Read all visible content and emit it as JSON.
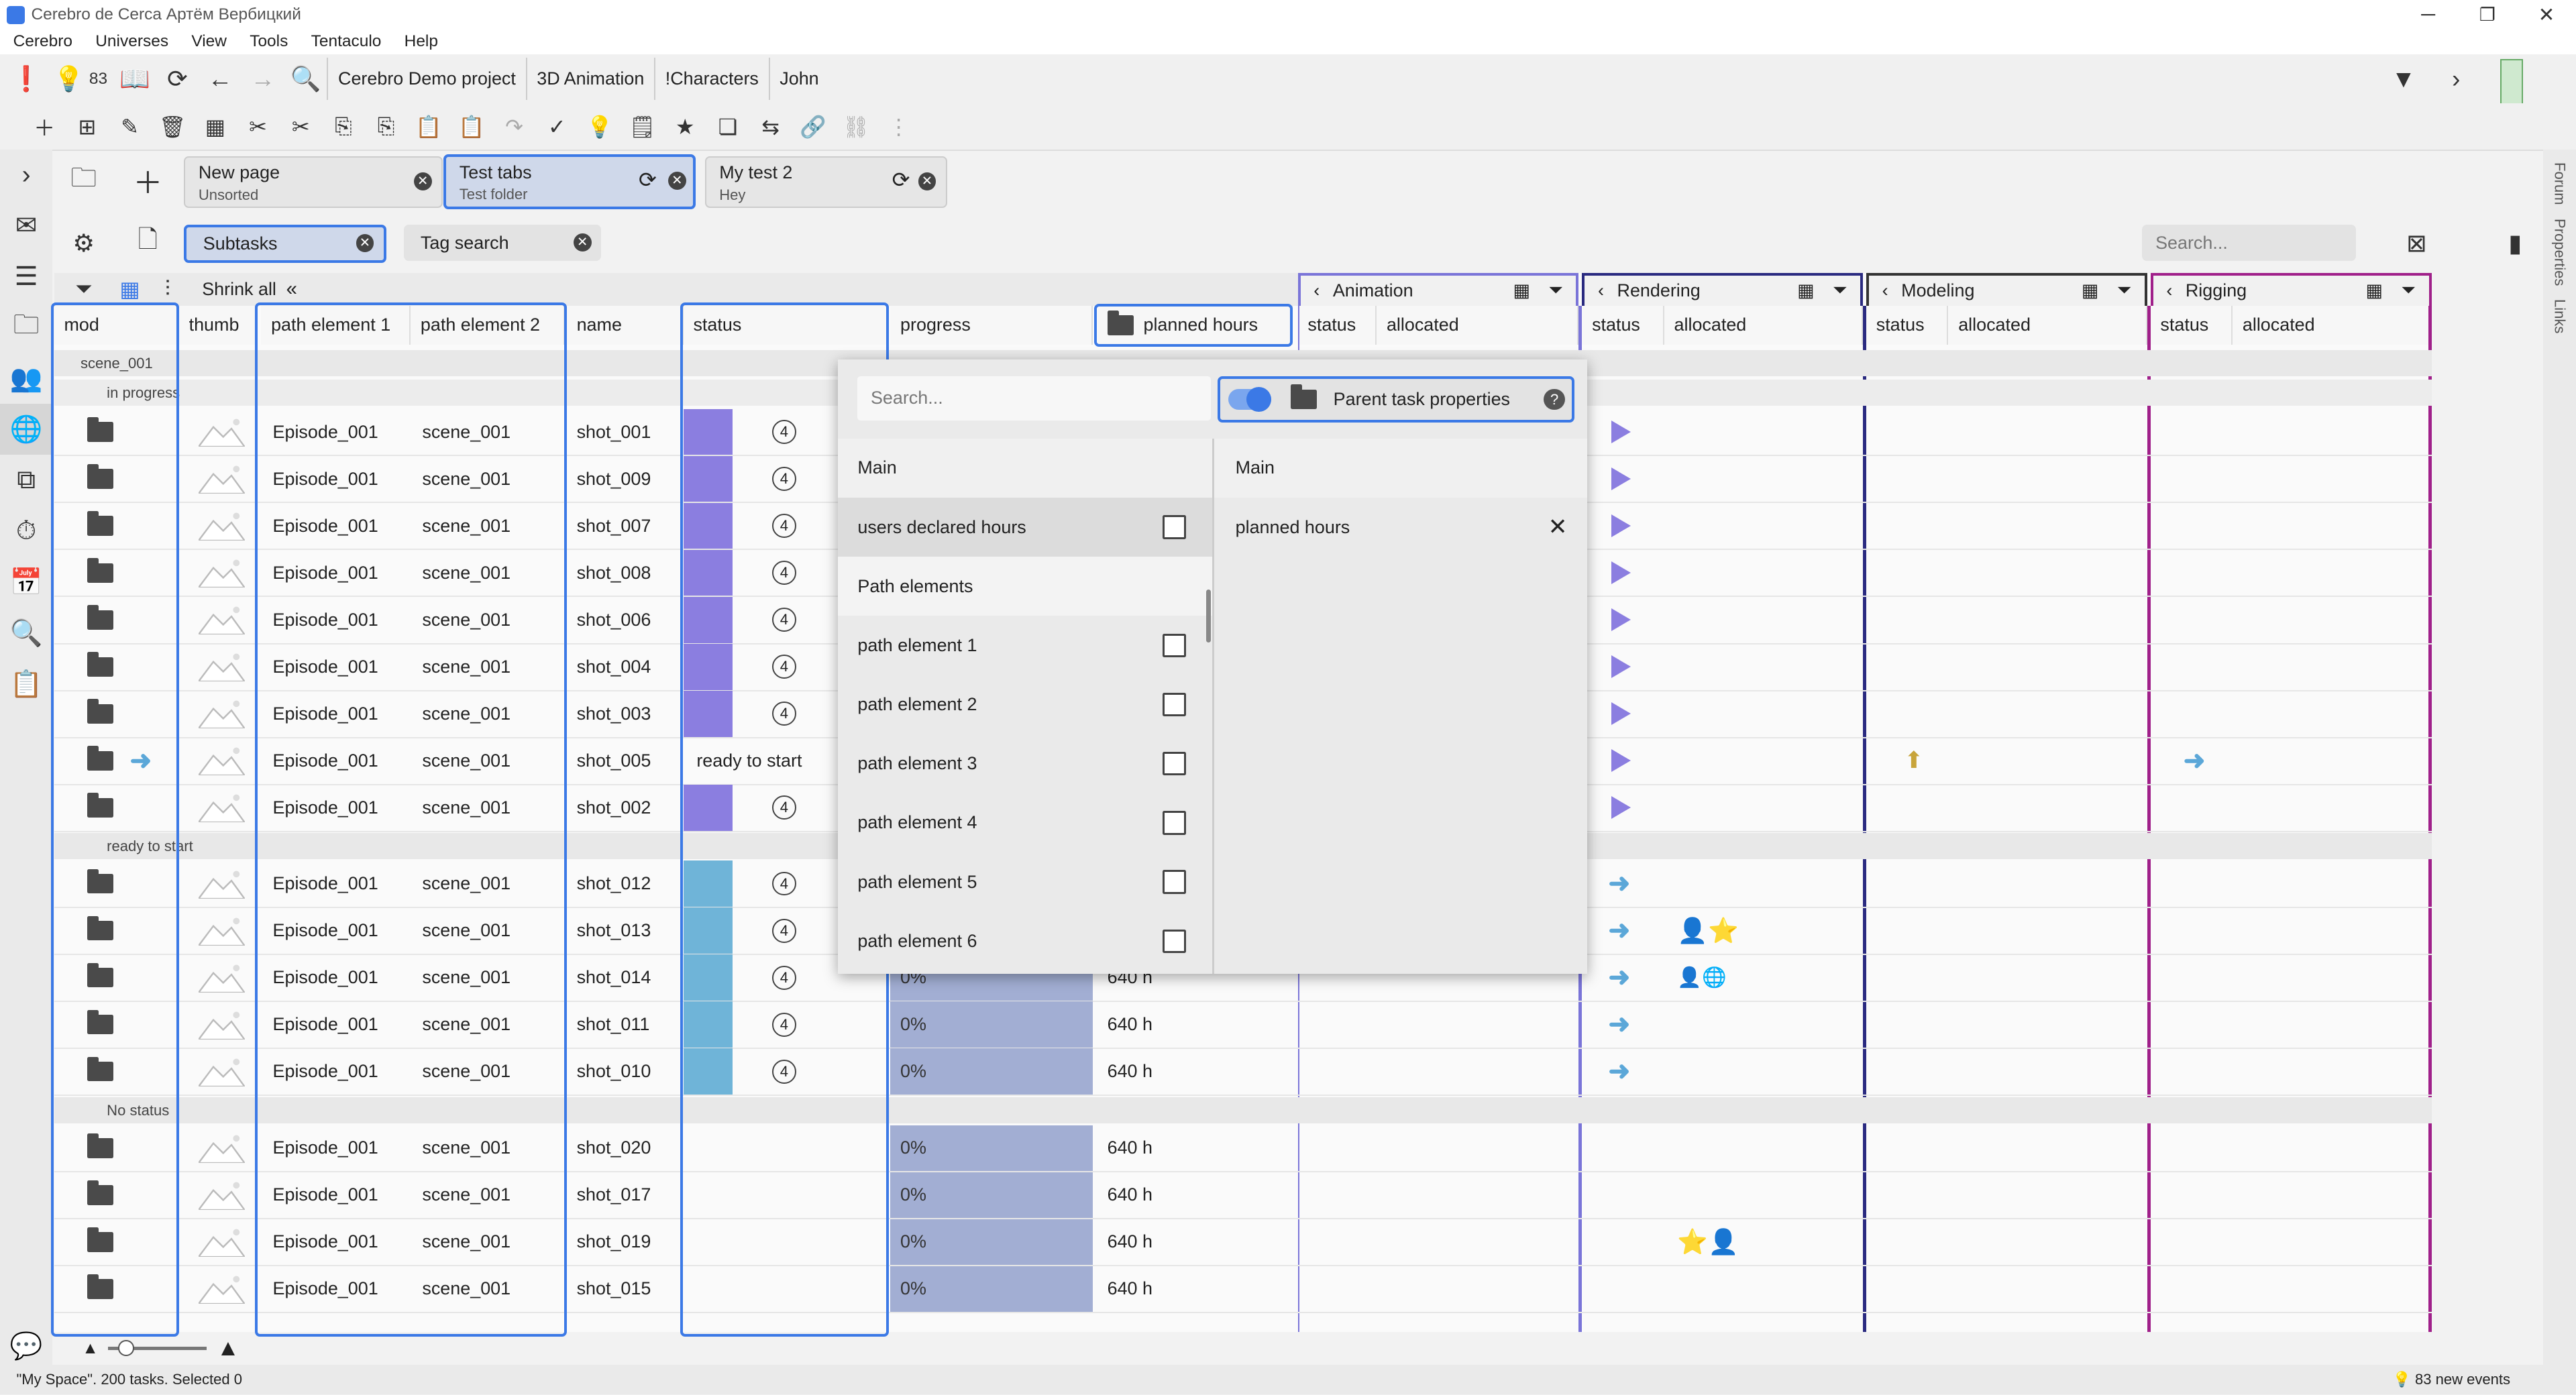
{
  "window": {
    "title": "Cerebro de Cerca  Артём Вербицкий"
  },
  "menu": [
    "Cerebro",
    "Universes",
    "View",
    "Tools",
    "Tentaculo",
    "Help"
  ],
  "toolbar": {
    "notification_count": "83",
    "breadcrumbs": [
      "Cerebro Demo project",
      "3D Animation",
      "!Characters",
      "John"
    ]
  },
  "tabs": [
    {
      "title": "New page",
      "subtitle": "Unsorted"
    },
    {
      "title": "Test tabs",
      "subtitle": "Test folder"
    },
    {
      "title": "My test 2",
      "subtitle": "Hey"
    }
  ],
  "filters": {
    "chip1": "Subtasks",
    "chip2": "Tag search",
    "search_placeholder": "Search...",
    "shrink_all": "Shrink all"
  },
  "columns": {
    "mod": "mod",
    "thumb": "thumb",
    "path1": "path element 1",
    "path2": "path element 2",
    "name": "name",
    "status": "status",
    "progress": "progress",
    "planned": "planned hours"
  },
  "sections": [
    {
      "name": "Animation",
      "status": "status",
      "allocated": "allocated"
    },
    {
      "name": "Rendering",
      "status": "status",
      "allocated": "allocated"
    },
    {
      "name": "Modeling",
      "status": "status",
      "allocated": "allocated"
    },
    {
      "name": "Rigging",
      "status": "status",
      "allocated": "allocated"
    }
  ],
  "groups": {
    "scene": "scene_001",
    "in_progress": "in progress",
    "ready": "ready to start",
    "no_status": "No status"
  },
  "rows_in_progress": [
    {
      "p1": "Episode_001",
      "p2": "scene_001",
      "name": "shot_001",
      "num": "4"
    },
    {
      "p1": "Episode_001",
      "p2": "scene_001",
      "name": "shot_009",
      "num": "4"
    },
    {
      "p1": "Episode_001",
      "p2": "scene_001",
      "name": "shot_007",
      "num": "4"
    },
    {
      "p1": "Episode_001",
      "p2": "scene_001",
      "name": "shot_008",
      "num": "4"
    },
    {
      "p1": "Episode_001",
      "p2": "scene_001",
      "name": "shot_006",
      "num": "4"
    },
    {
      "p1": "Episode_001",
      "p2": "scene_001",
      "name": "shot_004",
      "num": "4"
    },
    {
      "p1": "Episode_001",
      "p2": "scene_001",
      "name": "shot_003",
      "num": "4"
    },
    {
      "p1": "Episode_001",
      "p2": "scene_001",
      "name": "shot_005",
      "status": "ready to start"
    },
    {
      "p1": "Episode_001",
      "p2": "scene_001",
      "name": "shot_002",
      "num": "4"
    }
  ],
  "rows_ready": [
    {
      "p1": "Episode_001",
      "p2": "scene_001",
      "name": "shot_012",
      "num": "4"
    },
    {
      "p1": "Episode_001",
      "p2": "scene_001",
      "name": "shot_013",
      "num": "4"
    },
    {
      "p1": "Episode_001",
      "p2": "scene_001",
      "name": "shot_014",
      "num": "4",
      "progress": "0%",
      "planned": "640 h"
    },
    {
      "p1": "Episode_001",
      "p2": "scene_001",
      "name": "shot_011",
      "num": "4",
      "progress": "0%",
      "planned": "640 h"
    },
    {
      "p1": "Episode_001",
      "p2": "scene_001",
      "name": "shot_010",
      "num": "4",
      "progress": "0%",
      "planned": "640 h"
    }
  ],
  "rows_nostatus": [
    {
      "p1": "Episode_001",
      "p2": "scene_001",
      "name": "shot_020",
      "progress": "0%",
      "planned": "640 h"
    },
    {
      "p1": "Episode_001",
      "p2": "scene_001",
      "name": "shot_017",
      "progress": "0%",
      "planned": "640 h"
    },
    {
      "p1": "Episode_001",
      "p2": "scene_001",
      "name": "shot_019",
      "progress": "0%",
      "planned": "640 h"
    },
    {
      "p1": "Episode_001",
      "p2": "scene_001",
      "name": "shot_015",
      "progress": "0%",
      "planned": "640 h"
    }
  ],
  "popup": {
    "search_placeholder": "Search...",
    "toggle_label": "Parent task properties",
    "help": "?",
    "left_header": "Main",
    "right_header": "Main",
    "items": [
      {
        "label": "users declared hours",
        "checkbox": true
      },
      {
        "label": "Path elements",
        "checkbox": false
      },
      {
        "label": "path element 1",
        "checkbox": true
      },
      {
        "label": "path element 2",
        "checkbox": true
      },
      {
        "label": "path element 3",
        "checkbox": true
      },
      {
        "label": "path element 4",
        "checkbox": true
      },
      {
        "label": "path element 5",
        "checkbox": true
      },
      {
        "label": "path element 6",
        "checkbox": true
      }
    ],
    "selected": "planned hours"
  },
  "right_labels": [
    "Forum",
    "Properties",
    "Links"
  ],
  "status": {
    "left": "\"My Space\". 200 tasks. Selected 0",
    "right": "83 new events"
  },
  "colors": {
    "accent": "#3b79e6",
    "in_progress": "#8b7ee0",
    "ready": "#6fb4d8",
    "progress_bar": "#a2aed3",
    "animation": "#7a74d8",
    "rendering": "#2a2a80",
    "modeling": "#333333",
    "rigging": "#a0208a"
  }
}
